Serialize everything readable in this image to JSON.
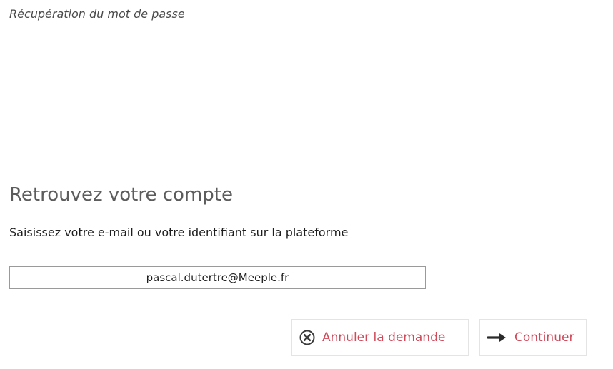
{
  "window": {
    "title": "Récupération du mot de passe"
  },
  "form": {
    "heading": "Retrouvez votre compte",
    "instruction": "Saisissez votre e-mail ou votre identifiant sur la plateforme",
    "identifier_value": "pascal.dutertre@Meeple.fr"
  },
  "actions": {
    "cancel_label": "Annuler la demande",
    "cancel_icon": "circle-x-icon",
    "continue_label": "Continuer",
    "continue_icon": "arrow-right-icon"
  },
  "colors": {
    "button_text": "#d04a5a",
    "heading": "#5c5c5c"
  }
}
